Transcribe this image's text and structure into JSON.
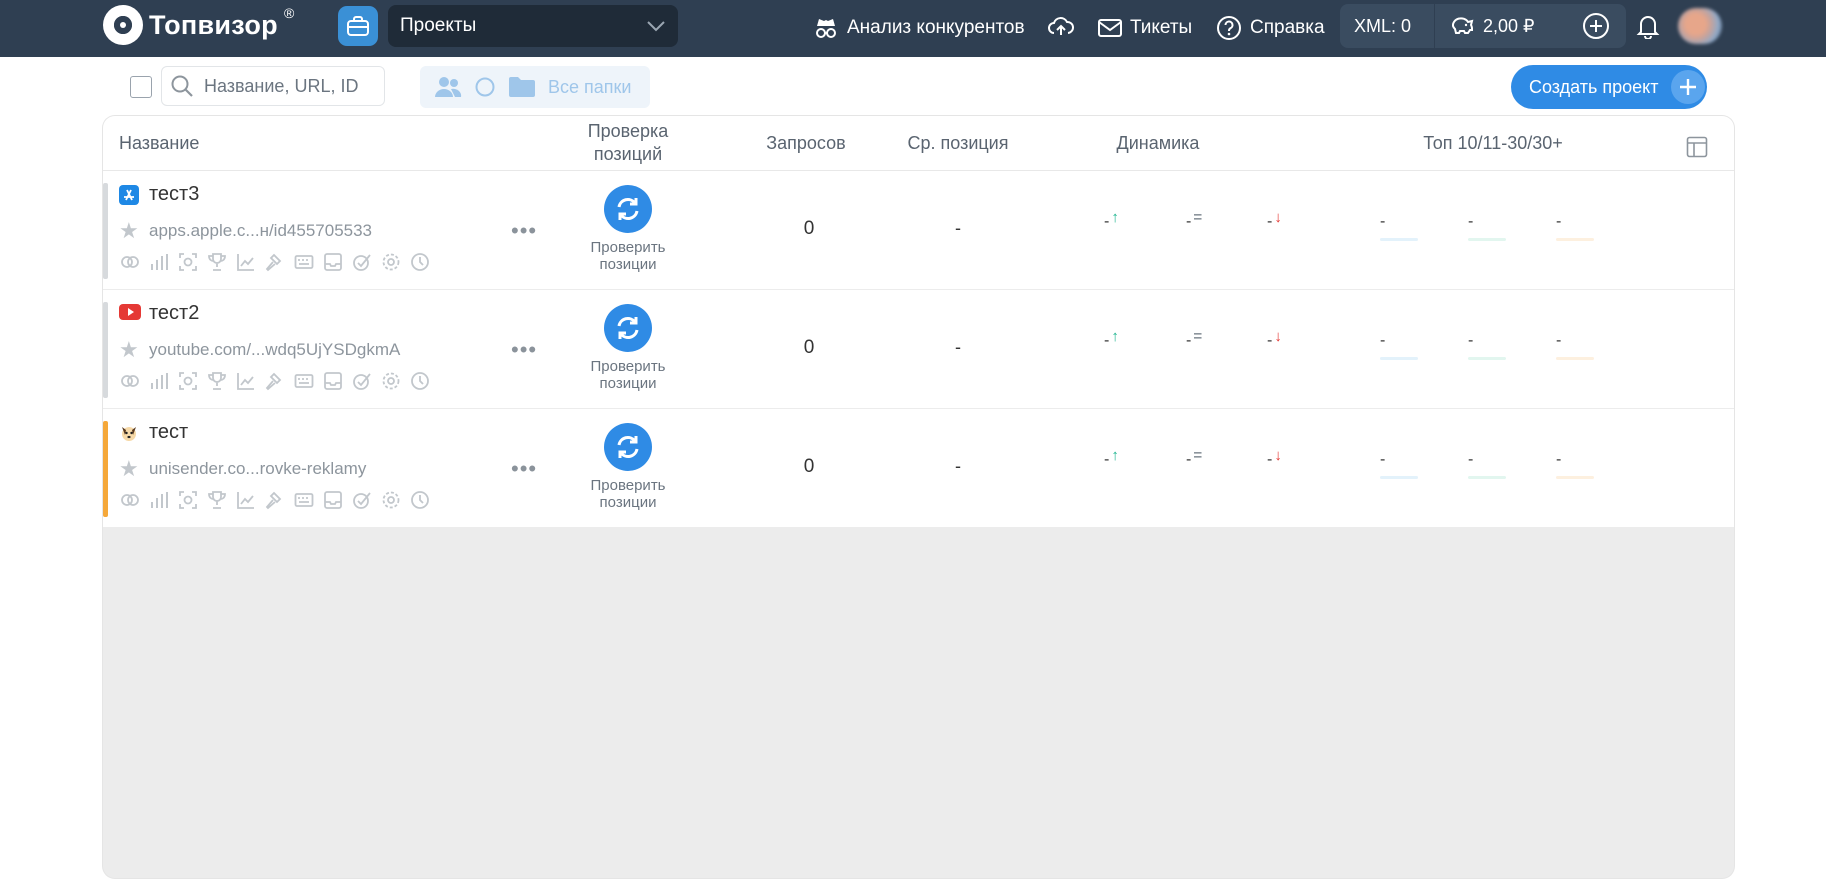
{
  "header": {
    "logo_text": "Топвизор",
    "logo_reg": "®",
    "project_select": "Проекты",
    "nav": {
      "competitors": "Анализ конкурентов",
      "tickets": "Тикеты",
      "help": "Справка"
    },
    "xml": "XML: 0",
    "balance": "2,00 ₽"
  },
  "toolbar": {
    "search_placeholder": "Название, URL, ID",
    "all_folders": "Все папки",
    "create_project": "Создать проект"
  },
  "table": {
    "headers": {
      "name": "Название",
      "check_positions_1": "Проверка",
      "check_positions_2": "позиций",
      "queries": "Запросов",
      "avg_position": "Ср. позиция",
      "dynamics": "Динамика",
      "top": "Топ 10/11-30/30+"
    },
    "rows": [
      {
        "name": "тест3",
        "url": "apps.apple.c...н/id455705533",
        "favicon": "app-store-icon",
        "marker": "#d7dadd",
        "check_1": "Проверить",
        "check_2": "позиции",
        "queries": "0",
        "avg": "-",
        "dyn_up": "-",
        "dyn_eq": "-",
        "dyn_down": "-",
        "top10": "-",
        "top11_30": "-",
        "top30": "-"
      },
      {
        "name": "тест2",
        "url": "youtube.com/...wdq5UjYSDgkmA",
        "favicon": "youtube-icon",
        "marker": "#d7dadd",
        "check_1": "Проверить",
        "check_2": "позиции",
        "queries": "0",
        "avg": "-",
        "dyn_up": "-",
        "dyn_eq": "-",
        "dyn_down": "-",
        "top10": "-",
        "top11_30": "-",
        "top30": "-"
      },
      {
        "name": "тест",
        "url": "unisender.co...rovke-reklamy",
        "favicon": "dog-icon",
        "marker": "#f5a83a",
        "check_1": "Проверить",
        "check_2": "позиции",
        "queries": "0",
        "avg": "-",
        "dyn_up": "-",
        "dyn_eq": "-",
        "dyn_down": "-",
        "top10": "-",
        "top11_30": "-",
        "top30": "-"
      }
    ]
  },
  "colors": {
    "topbar": "#2f3f52",
    "accent": "#2f8be5",
    "up": "#1fb58f",
    "down": "#e53935",
    "eq": "#8d959d"
  }
}
